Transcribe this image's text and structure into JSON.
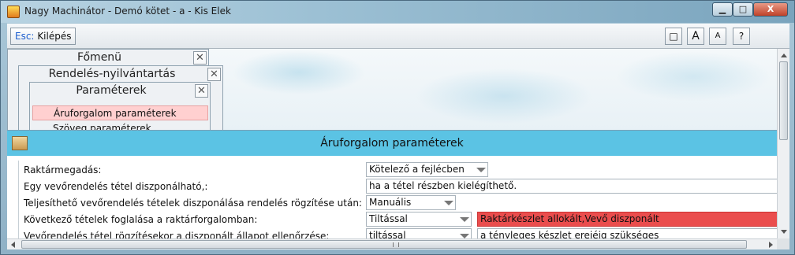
{
  "window": {
    "title": "Nagy Machinátor - Demó kötet - a - Kis Elek",
    "min_label": "▁",
    "max_label": "□",
    "close_label": "X"
  },
  "toolbar": {
    "esc_key": "Esc:",
    "esc_label": "Kilépés",
    "window_btn_label": "□",
    "font_large_label": "A",
    "font_small_label": "A",
    "help_label": "?"
  },
  "menus": {
    "main_menu": "Főmenü",
    "orders_menu": "Rendelés-nyilvántartás",
    "params_menu": "Paraméterek",
    "close_label": "✕",
    "items": [
      {
        "label": "Áruforgalom paraméterek",
        "selected": true
      },
      {
        "label": "Szöveg paraméterek",
        "selected": false
      }
    ]
  },
  "params": {
    "title": "Áruforgalom paraméterek",
    "rows": [
      {
        "label": "Raktármegadás:",
        "value": "Kötelező a fejlécben",
        "extra": ""
      },
      {
        "label": "Egy vevőrendelés tétel diszponálható,:",
        "value": "ha a tétel részben kielégíthető.",
        "extra": ""
      },
      {
        "label": "Teljesíthető vevőrendelés tételek diszponálása rendelés rögzítése után:",
        "value": "Manuális",
        "extra": ""
      },
      {
        "label": "Következő tételek foglalása a raktárforgalomban:",
        "value": "Tiltással",
        "extra": "Raktárkészlet allokált,Vevő diszponált"
      },
      {
        "label": "Vevőrendelés tétel rögzítésekor a diszponált állapot ellenőrzése:",
        "value": "tiltással",
        "extra": "a tényleges készlet erejéig szükséges"
      }
    ]
  },
  "colors": {
    "header_bg": "#5bc3e4",
    "selected_item_bg": "#ffd0d0",
    "alert_field_bg": "#ea4d4d"
  }
}
